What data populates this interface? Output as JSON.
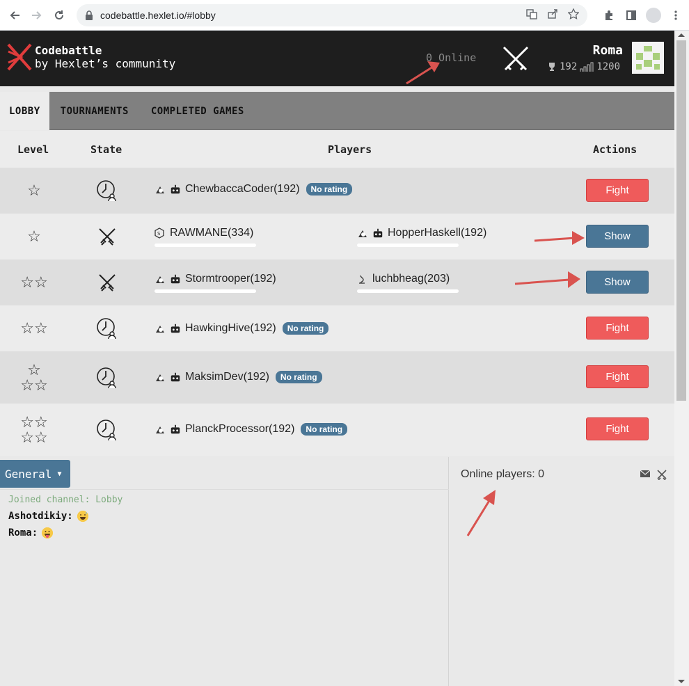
{
  "browser": {
    "url": "codebattle.hexlet.io/#lobby"
  },
  "header": {
    "logo_line1": "Codebattle",
    "logo_line2": "by Hexlet’s community",
    "online": "0 Online",
    "user_name": "Roma",
    "user_rank": "192",
    "user_rating": "1200"
  },
  "tabs": [
    {
      "label": "LOBBY",
      "active": true
    },
    {
      "label": "TOURNAMENTS",
      "active": false
    },
    {
      "label": "COMPLETED GAMES",
      "active": false
    }
  ],
  "table": {
    "headers": {
      "level": "Level",
      "state": "State",
      "players": "Players",
      "actions": "Actions"
    },
    "rows": [
      {
        "stars": 1,
        "state": "waiting",
        "p1": "ChewbaccaCoder(192)",
        "badge": "No rating",
        "action": "Fight"
      },
      {
        "stars": 1,
        "state": "playing",
        "p1": "RAWMANE(334)",
        "p2": "HopperHaskell(192)",
        "action": "Show"
      },
      {
        "stars": 2,
        "state": "playing",
        "p1": "Stormtrooper(192)",
        "p2": "luchbheag(203)",
        "action": "Show"
      },
      {
        "stars": 2,
        "state": "waiting",
        "p1": "HawkingHive(192)",
        "badge": "No rating",
        "action": "Fight"
      },
      {
        "stars": 3,
        "state": "waiting",
        "p1": "MaksimDev(192)",
        "badge": "No rating",
        "action": "Fight"
      },
      {
        "stars": 4,
        "state": "waiting",
        "p1": "PlanckProcessor(192)",
        "badge": "No rating",
        "action": "Fight"
      }
    ]
  },
  "chat": {
    "channel": "General",
    "system_message": "Joined channel: Lobby",
    "messages": [
      {
        "author": "Ashotdikiy:"
      },
      {
        "author": "Roma:"
      }
    ]
  },
  "online_panel": {
    "title": "Online players: 0"
  },
  "colors": {
    "header_bg": "#1e1e1e",
    "fight": "#ef5b5b",
    "show": "#4a7696",
    "badge": "#4a7696",
    "annotation": "#d9534f"
  }
}
